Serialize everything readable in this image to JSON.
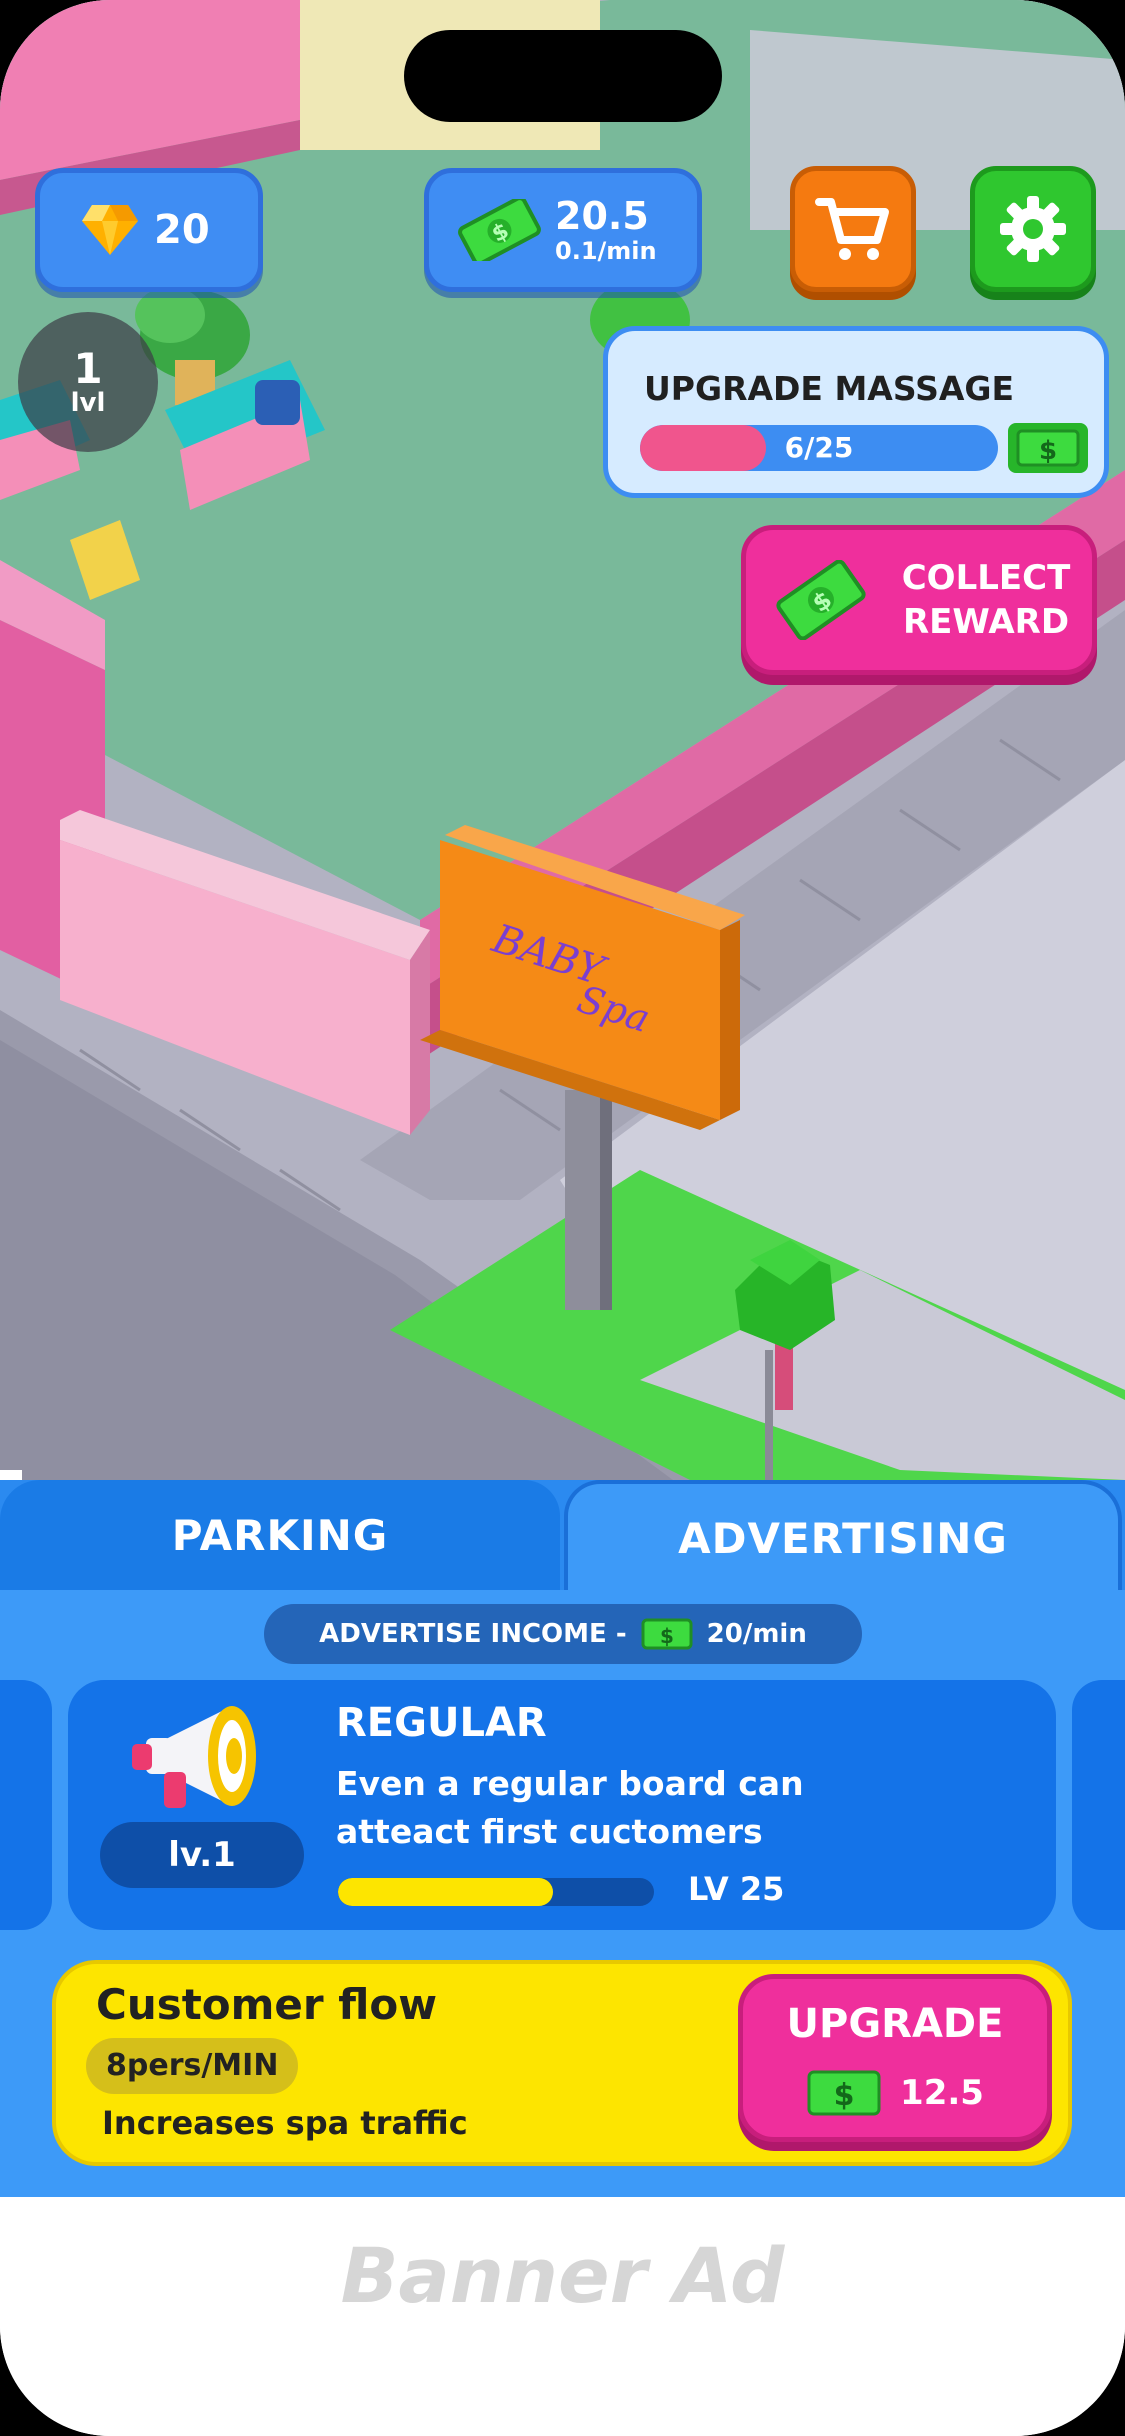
{
  "hud": {
    "gems": "20",
    "cash_amount": "20.5",
    "cash_rate": "0.1/min",
    "level_number": "1",
    "level_label": "lvl"
  },
  "quest": {
    "title": "UPGRADE MASSAGE",
    "progress_text": "6/25",
    "progress": 0.24
  },
  "collect_reward": {
    "line1": "COLLECT",
    "line2": "REWARD"
  },
  "sign": {
    "line1": "BABY",
    "line2": "Spa"
  },
  "tabs": [
    {
      "label": "PARKING",
      "active": false
    },
    {
      "label": "ADVERTISING",
      "active": true
    }
  ],
  "income": {
    "label": "ADVERTISE INCOME -",
    "value": "20/min"
  },
  "ad_card": {
    "title": "REGULAR",
    "desc_line1": "Even a regular board can",
    "desc_line2": "atteact first cuctomers",
    "level_badge": "lv.1",
    "progress": 0.68,
    "max_level": "LV 25"
  },
  "flow": {
    "title": "Customer flow",
    "rate": "8pers/MIN",
    "desc": "Increases spa traffic",
    "upgrade_label": "UPGRADE",
    "upgrade_cost": "12.5"
  },
  "banner": {
    "text": "Banner Ad"
  },
  "colors": {
    "panel_blue": "#2b8af0",
    "tab_active": "#3d9af8",
    "card_blue": "#1473e8",
    "yellow": "#fde500",
    "pink": "#ef2f9c",
    "green_button": "#2fc72f",
    "orange_button": "#f57a10"
  }
}
